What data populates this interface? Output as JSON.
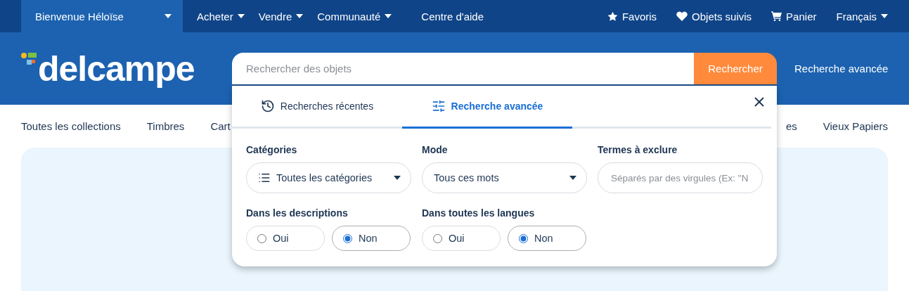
{
  "top_bar": {
    "welcome": "Bienvenue Héloïse",
    "menus": [
      {
        "label": "Acheter",
        "dropdown": true
      },
      {
        "label": "Vendre",
        "dropdown": true
      },
      {
        "label": "Communauté",
        "dropdown": true
      },
      {
        "label": "Centre d'aide",
        "dropdown": false
      }
    ],
    "right": [
      {
        "label": "Favoris",
        "kind": "star"
      },
      {
        "label": "Objets suivis",
        "kind": "heart"
      },
      {
        "label": "Panier",
        "kind": "cart"
      },
      {
        "label": "Français",
        "kind": "language"
      }
    ]
  },
  "logo": "delcampe",
  "search": {
    "placeholder": "Rechercher des objets",
    "button": "Rechercher",
    "advanced_link": "Recherche avancée"
  },
  "categories_nav": {
    "left": [
      "Toutes les collections",
      "Timbres",
      "Cart"
    ],
    "right": [
      "es",
      "Vieux Papiers"
    ]
  },
  "panel": {
    "tabs": [
      {
        "label": "Recherches récentes",
        "kind": "history",
        "selected": false
      },
      {
        "label": "Recherche avancée",
        "kind": "filters",
        "selected": true
      }
    ],
    "fields": [
      {
        "label": "Catégories",
        "kind": "select",
        "value": "Toutes les catégories",
        "icon": true
      },
      {
        "label": "Mode",
        "kind": "select",
        "value": "Tous ces mots",
        "icon": false
      },
      {
        "label": "Termes à exclure",
        "kind": "text",
        "placeholder": "Séparés par des virgules (Ex: \"N"
      }
    ],
    "radios": [
      {
        "label": "Dans les descriptions",
        "options": [
          {
            "label": "Oui",
            "selected": false
          },
          {
            "label": "Non",
            "selected": true
          }
        ]
      },
      {
        "label": "Dans toutes les langues",
        "options": [
          {
            "label": "Oui",
            "selected": false
          },
          {
            "label": "Non",
            "selected": true
          }
        ]
      }
    ]
  }
}
